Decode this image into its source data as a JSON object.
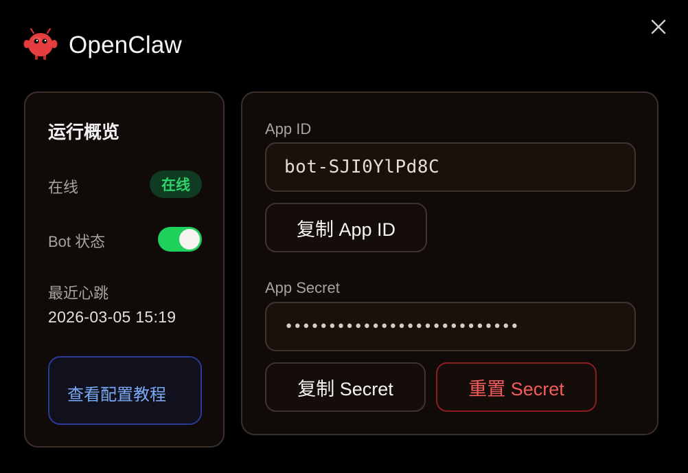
{
  "app": {
    "title": "OpenClaw",
    "logo_icon": "red-lobster-mascot-icon"
  },
  "window": {
    "close_icon": "close-icon"
  },
  "overview": {
    "title": "运行概览",
    "online_label": "在线",
    "online_badge": "在线",
    "bot_status_label": "Bot 状态",
    "bot_enabled": true,
    "heartbeat_label": "最近心跳",
    "heartbeat_value": "2026-03-05 15:19",
    "tutorial_button": "查看配置教程"
  },
  "credentials": {
    "app_id_label": "App ID",
    "app_id_value": "bot-SJI0YlPd8C",
    "copy_app_id_button": "复制 App ID",
    "secret_label": "App Secret",
    "secret_value": "•••••••••••••••••••••••••••",
    "copy_secret_button": "复制 Secret",
    "reset_secret_button": "重置 Secret"
  },
  "colors": {
    "background": "#000000",
    "panel": "#100a09",
    "online_green": "#2fd36c",
    "toggle_green": "#1fd05a",
    "link_blue": "#7aaaf6",
    "danger_red": "#f45c5c"
  }
}
